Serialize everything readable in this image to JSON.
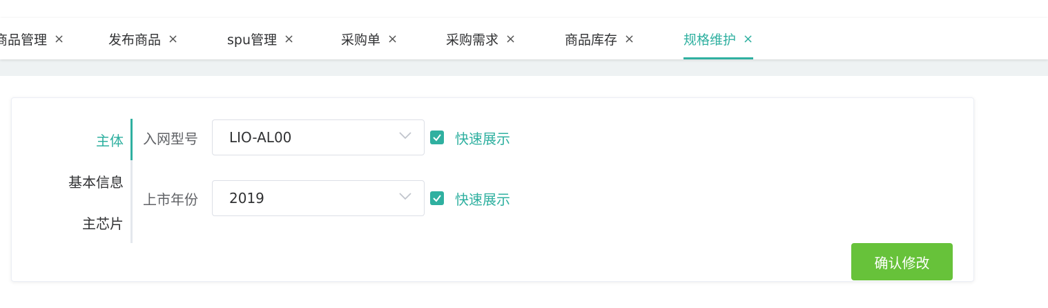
{
  "tabs": [
    {
      "label": "商品管理",
      "close": "×"
    },
    {
      "label": "发布商品",
      "close": "×"
    },
    {
      "label": "spu管理",
      "close": "×"
    },
    {
      "label": "采购单",
      "close": "×"
    },
    {
      "label": "采购需求",
      "close": "×"
    },
    {
      "label": "商品库存",
      "close": "×"
    },
    {
      "label": "规格维护",
      "close": "×",
      "active": true
    }
  ],
  "side_nav": {
    "items": [
      {
        "label": "主体",
        "active": true
      },
      {
        "label": "基本信息"
      },
      {
        "label": "主芯片"
      }
    ]
  },
  "form": {
    "rows": [
      {
        "label": "入网型号",
        "value": "LIO-AL00",
        "checkbox_label": "快速展示",
        "checked": true
      },
      {
        "label": "上市年份",
        "value": "2019",
        "checkbox_label": "快速展示",
        "checked": true
      }
    ]
  },
  "actions": {
    "confirm_label": "确认修改"
  },
  "colors": {
    "accent": "#2fb0a0",
    "confirm": "#67c23a",
    "band": "#eef2f3"
  },
  "icons": {
    "tab_close": "close-icon",
    "select_arrow": "chevron-down-icon",
    "checkbox": "check-icon"
  }
}
